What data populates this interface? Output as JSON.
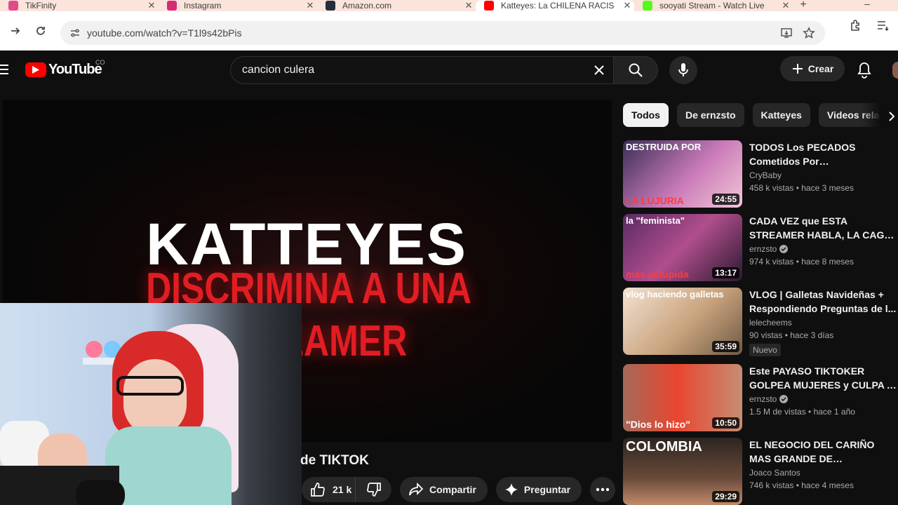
{
  "browser": {
    "tabs": [
      {
        "label": "TikFinity",
        "color": "#e34a8a",
        "active": false
      },
      {
        "label": "Instagram",
        "color": "#d62976",
        "active": false
      },
      {
        "label": "Amazon.com",
        "color": "#232f3e",
        "active": false
      },
      {
        "label": "Katteyes: La CHILENA RACIS",
        "color": "#ff0000",
        "active": true
      },
      {
        "label": "sooyati Stream - Watch Live",
        "color": "#53fc18",
        "active": false
      }
    ],
    "url": "youtube.com/watch?v=T1l9s42bPis"
  },
  "masthead": {
    "logo_text": "YouTube",
    "country": "CO",
    "search_value": "cancion culera",
    "create_label": "Crear"
  },
  "player": {
    "title_big": "KATTEYES",
    "title_red": "DISCRIMINA A UNA STREAMER"
  },
  "video": {
    "title_fragment": "de TIKTOK",
    "likes": "21 k",
    "share_label": "Compartir",
    "ask_label": "Preguntar"
  },
  "chips": [
    "Todos",
    "De ernzsto",
    "Katteyes",
    "Videos relac"
  ],
  "recommended": [
    {
      "title": "TODOS Los PECADOS Cometidos Por ARIGAMEPLAY...",
      "channel": "CryBaby",
      "verified": false,
      "stats": "458 k vistas • hace 3 meses",
      "duration": "24:55",
      "badge": "",
      "thumb_top": "DESTRUIDA POR",
      "thumb_bottom": "LA LUJURIA",
      "bg": "linear-gradient(135deg,#3a2f55 0%,#c97ab8 55%,#f2c6d6 100%)"
    },
    {
      "title": "CADA VEZ que ESTA STREAMER HABLA, LA CAGA: ...",
      "channel": "ernzsto",
      "verified": true,
      "stats": "974 k vistas • hace 8 meses",
      "duration": "13:17",
      "badge": "",
      "thumb_top": "la \"feminista\"",
      "thumb_bottom": "más estúpida",
      "bg": "linear-gradient(135deg,#5a2b63 0%,#b04e8d 50%,#2a1a2f 100%)"
    },
    {
      "title": "VLOG | Galletas Navideñas + Respondiendo Preguntas de l...",
      "channel": "lelecheems",
      "verified": false,
      "stats": "90 vistas • hace 3 días",
      "duration": "35:59",
      "badge": "Nuevo",
      "thumb_top": "vlog haciendo galletas",
      "thumb_bottom": "",
      "bg": "linear-gradient(135deg,#f1e2d2 0%,#c9a27c 55%,#6d5a46 100%)"
    },
    {
      "title": "Este PAYASO TIKTOKER GOLPEA MUJERES y CULPA A ...",
      "channel": "ernzsto",
      "verified": true,
      "stats": "1.5 M de vistas • hace 1 año",
      "duration": "10:50",
      "badge": "",
      "thumb_top": "",
      "thumb_bottom": "\"Dios lo hizo\"",
      "bg": "linear-gradient(90deg,#a46a5a 0%,#e9462f 45%,#c58d73 100%)"
    },
    {
      "title": "EL NEGOCIO DEL CARIÑO MAS GRANDE DE LATINOAMERICA ...",
      "channel": "Joaco Santos",
      "verified": false,
      "stats": "746 k vistas • hace 4 meses",
      "duration": "29:29",
      "badge": "",
      "thumb_top": "COLOMBIA",
      "thumb_bottom": "",
      "bg": "linear-gradient(180deg,#2c2520 0%,#6a4a3a 60%,#c08a6a 100%)"
    }
  ]
}
